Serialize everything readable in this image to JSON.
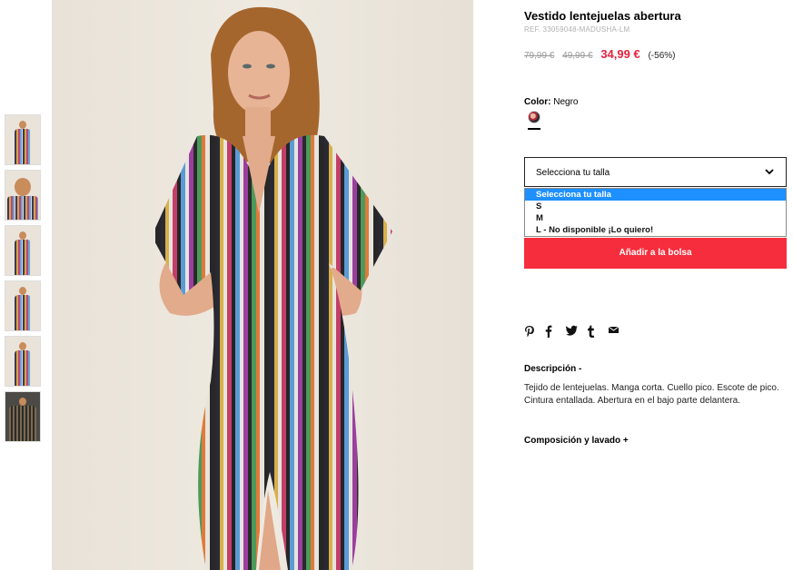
{
  "thumbnails": [
    {
      "label": "thumbnail-1"
    },
    {
      "label": "thumbnail-2"
    },
    {
      "label": "thumbnail-3"
    },
    {
      "label": "thumbnail-4"
    },
    {
      "label": "thumbnail-5"
    },
    {
      "label": "thumbnail-6"
    }
  ],
  "product": {
    "title": "Vestido lentejuelas abertura",
    "ref": "REF. 33059048-MADUSHA-LM",
    "price_old_1": "79,99 €",
    "price_old_2": "49,99 €",
    "price_sale": "34,99 €",
    "discount": "(-56%)"
  },
  "color": {
    "label": "Color:",
    "value": "Negro"
  },
  "size_select": {
    "selected": "Selecciona tu talla",
    "options": [
      "Selecciona tu talla",
      "S",
      "M",
      "L - No disponible ¡Lo quiero!"
    ]
  },
  "add_button": "Añadir a la bolsa",
  "share_icons": [
    "pinterest-icon",
    "facebook-icon",
    "twitter-icon",
    "tumblr-icon",
    "mail-icon"
  ],
  "description": {
    "heading": "Descripción -",
    "text": "Tejido de lentejuelas. Manga corta. Cuello pico. Escote de pico. Cintura entallada. Abertura en el bajo parte delantera."
  },
  "composition": {
    "heading": "Composición y lavado +"
  },
  "colors": {
    "accent": "#f62d3d",
    "sale_price": "#e6223f",
    "option_highlight": "#1e90ff"
  }
}
